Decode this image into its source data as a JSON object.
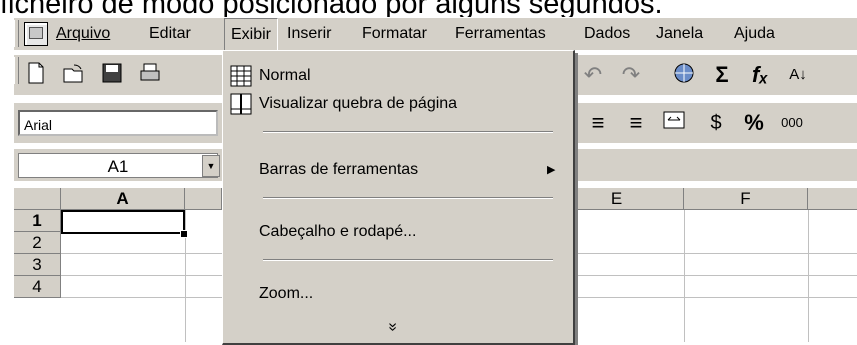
{
  "caption": "ficheiro de modo posicionado por alguns segundos.",
  "menubar": {
    "items": [
      {
        "label": "Arquivo"
      },
      {
        "label": "Editar"
      },
      {
        "label": "Exibir"
      },
      {
        "label": "Inserir"
      },
      {
        "label": "Formatar"
      },
      {
        "label": "Ferramentas"
      },
      {
        "label": "Dados"
      },
      {
        "label": "Janela"
      },
      {
        "label": "Ajuda"
      }
    ],
    "active": "Exibir"
  },
  "toolbar": {
    "icons": [
      "new-document-icon",
      "open-folder-icon",
      "save-disk-icon",
      "print-icon",
      "undo-icon",
      "redo-icon",
      "web-icon",
      "autosum-icon",
      "function-icon",
      "sort-icon"
    ],
    "symbols": {
      "sigma": "Σ",
      "fx": "fₓ",
      "sort": "A↓"
    }
  },
  "format_bar": {
    "font": "Arial",
    "currency": "$",
    "percent": "%",
    "thousands": "000"
  },
  "name_box": {
    "value": "A1"
  },
  "grid": {
    "columns": [
      "A",
      "E",
      "F"
    ],
    "rows": [
      "1",
      "2",
      "3",
      "4"
    ]
  },
  "dropdown": {
    "items": [
      {
        "label": "Normal"
      },
      {
        "label": "Visualizar quebra de página"
      },
      {
        "label": "Barras de ferramentas"
      },
      {
        "label": "Cabeçalho e rodapé..."
      },
      {
        "label": "Zoom..."
      }
    ],
    "expand_symbol": "»"
  },
  "colors": {
    "chrome": "#d4d0c8",
    "shadow": "#808080"
  }
}
